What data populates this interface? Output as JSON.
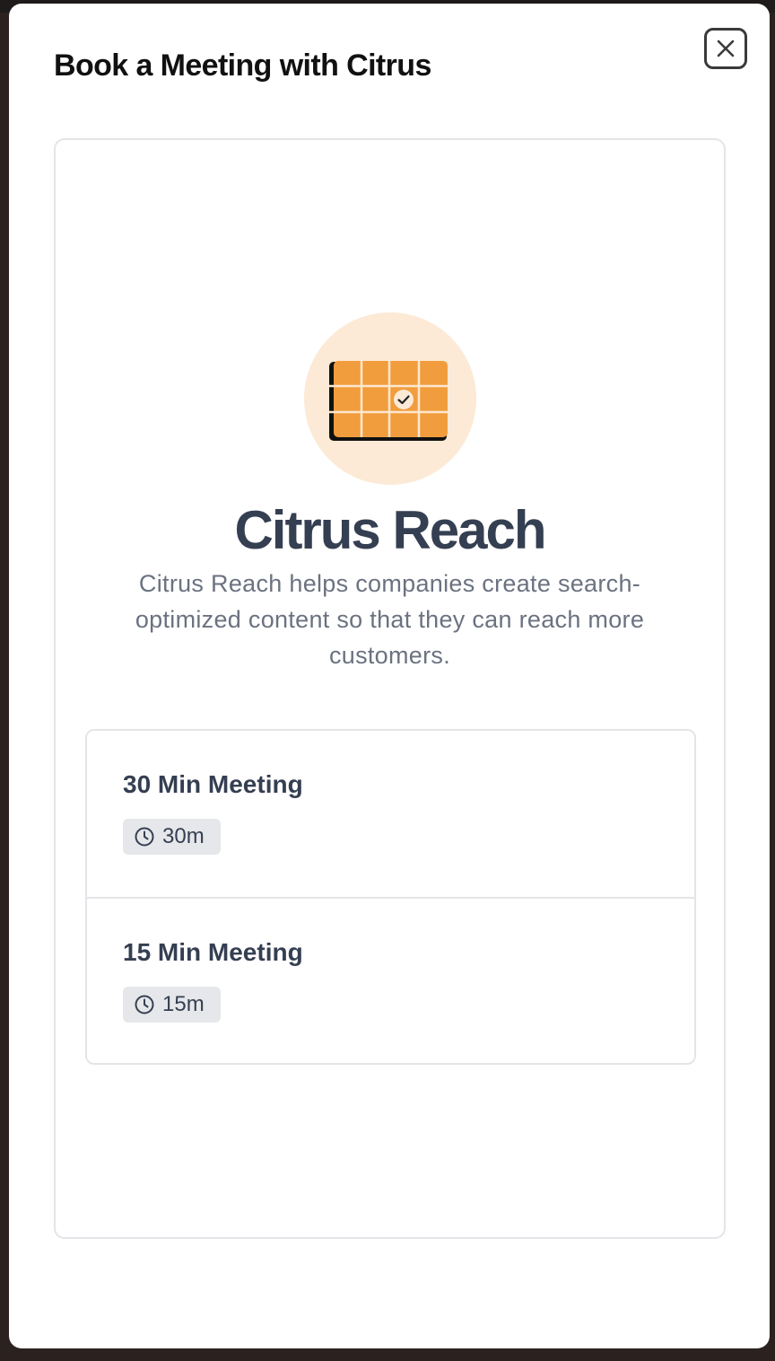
{
  "modal": {
    "title": "Book a Meeting with Citrus",
    "close_icon": "close-icon"
  },
  "profile": {
    "icon": "calendar-check-icon",
    "name": "Citrus Reach",
    "description": "Citrus Reach helps companies create search-optimized content so that they can reach more customers."
  },
  "meetings": [
    {
      "name": "30 Min Meeting",
      "duration": "30m",
      "icon": "clock-icon"
    },
    {
      "name": "15 Min Meeting",
      "duration": "15m",
      "icon": "clock-icon"
    }
  ],
  "colors": {
    "accent_orange": "#f19d3d",
    "hero_background": "#fcead6",
    "heading": "#353f52",
    "muted_text": "#6b7280",
    "badge_background": "#e6e7ea"
  }
}
